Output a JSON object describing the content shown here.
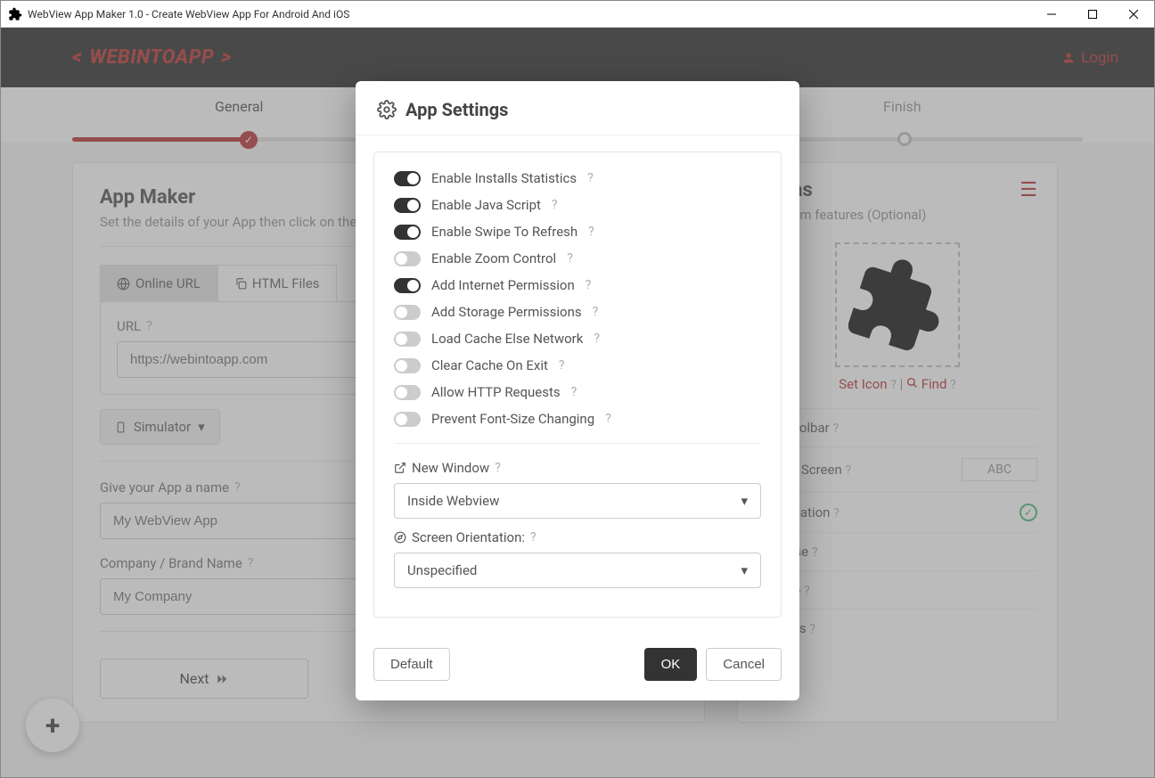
{
  "window": {
    "title": "WebView App Maker 1.0 - Create WebView App For Android And iOS"
  },
  "brand": {
    "text": "WEBINTOAPP"
  },
  "login": "Login",
  "wizard": {
    "step1": "General",
    "step2": "Finish"
  },
  "left": {
    "title": "App Maker",
    "subtitle": "Set the details of your App then click on the",
    "tab_online": "Online URL",
    "tab_html": "HTML Files",
    "url_label": "URL",
    "url_value": "https://webintoapp.com",
    "simulator": "Simulator",
    "name_label": "Give your App a name",
    "name_value": "My WebView App",
    "company_label": "Company / Brand Name",
    "company_value": "My Company",
    "next": "Next"
  },
  "right": {
    "title": "Extras",
    "subtitle": "Premium features (Optional)",
    "set_icon": "Set Icon",
    "find": "Find",
    "rows": {
      "toolbar": "App Toolbar",
      "splash": "Splash Screen",
      "splash_abc": "ABC",
      "cert": "Certification",
      "firebase": "Firebase",
      "admob": "AdMob",
      "settings": "Settings"
    }
  },
  "modal": {
    "title": "App Settings",
    "toggles": [
      {
        "label": "Enable Installs Statistics",
        "on": true
      },
      {
        "label": "Enable Java Script",
        "on": true
      },
      {
        "label": "Enable Swipe To Refresh",
        "on": true
      },
      {
        "label": "Enable Zoom Control",
        "on": false
      },
      {
        "label": "Add Internet Permission",
        "on": true
      },
      {
        "label": "Add Storage Permissions",
        "on": false
      },
      {
        "label": "Load Cache Else Network",
        "on": false
      },
      {
        "label": "Clear Cache On Exit",
        "on": false
      },
      {
        "label": "Allow HTTP Requests",
        "on": false
      },
      {
        "label": "Prevent Font-Size Changing",
        "on": false
      }
    ],
    "new_window_label": "New Window",
    "new_window_value": "Inside Webview",
    "orientation_label": "Screen Orientation:",
    "orientation_value": "Unspecified",
    "default_btn": "Default",
    "ok_btn": "OK",
    "cancel_btn": "Cancel"
  }
}
